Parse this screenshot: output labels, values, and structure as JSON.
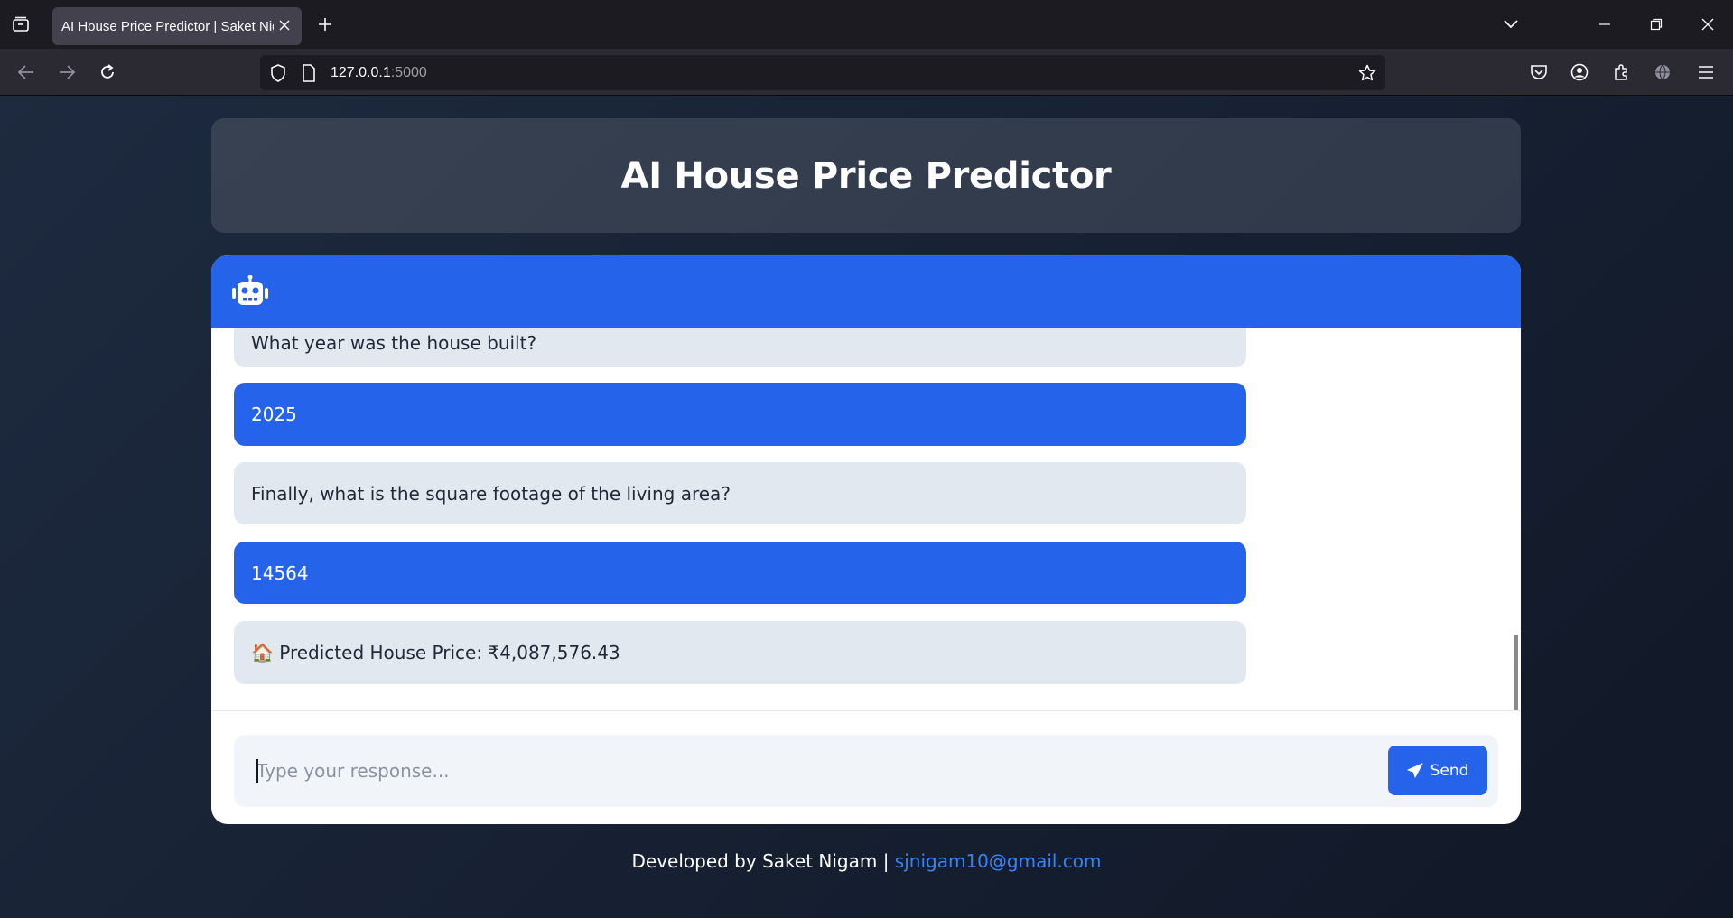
{
  "browser": {
    "tab_title": "AI House Price Predictor | Saket Nigam",
    "url_host": "127.0.0.1",
    "url_port": ":5000"
  },
  "header": {
    "title": "AI House Price Predictor"
  },
  "chat": {
    "messages": [
      {
        "role": "bot",
        "text": "What year was the house built?"
      },
      {
        "role": "user",
        "text": "2025"
      },
      {
        "role": "bot",
        "text": "Finally, what is the square footage of the living area?"
      },
      {
        "role": "user",
        "text": "14564"
      },
      {
        "role": "bot",
        "text": "🏠 Predicted House Price: ₹4,087,576.43"
      }
    ],
    "input": {
      "value": "",
      "placeholder": "Type your response..."
    },
    "send_label": "Send"
  },
  "footer": {
    "prefix": "Developed by Saket Nigam | ",
    "email": "sjnigam10@gmail.com"
  },
  "colors": {
    "accent": "#2563eb",
    "bot_bubble": "#e2e8f0",
    "page_bg": "#111827"
  },
  "icons": [
    "tab-list-icon",
    "close-icon",
    "plus-icon",
    "chevron-down-icon",
    "minimize-icon",
    "restore-icon",
    "back-arrow-icon",
    "forward-arrow-icon",
    "reload-icon",
    "shield-icon",
    "page-icon",
    "star-icon",
    "pocket-icon",
    "account-icon",
    "extensions-icon",
    "globe-icon",
    "menu-icon",
    "robot-icon",
    "paper-plane-icon"
  ]
}
